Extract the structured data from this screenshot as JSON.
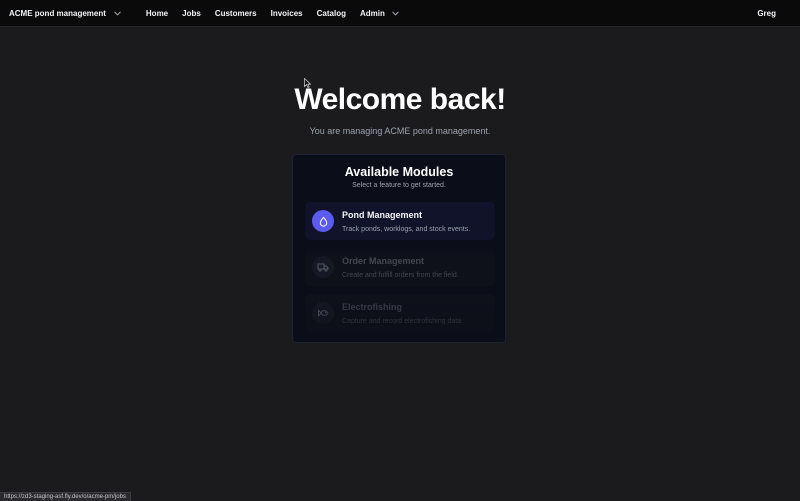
{
  "navbar": {
    "brand": "ACME pond management",
    "links": [
      "Home",
      "Jobs",
      "Customers",
      "Invoices",
      "Catalog"
    ],
    "admin": "Admin",
    "user": "Greg"
  },
  "hero": {
    "title": "Welcome back!",
    "subtitle": "You are managing ACME pond management."
  },
  "modules_card": {
    "title": "Available Modules",
    "subtitle": "Select a feature to get started.",
    "items": [
      {
        "title": "Pond Management",
        "description": "Track ponds, worklogs, and stock events.",
        "icon": "water-drop-icon",
        "enabled": true
      },
      {
        "title": "Order Management",
        "description": "Create and fulfill orders from the field.",
        "icon": "truck-icon",
        "enabled": false
      },
      {
        "title": "Electrofishing",
        "description": "Capture and record electrofishing data.",
        "icon": "fish-icon",
        "enabled": false
      }
    ]
  },
  "status_url": "https://zd3-staging-asf.fly.dev/o/acme-pm/jobs",
  "colors": {
    "accent": "#5b5bf0",
    "background": "#1b1b1d",
    "navbar": "#0a0a0b",
    "card": "#0b0d18"
  }
}
